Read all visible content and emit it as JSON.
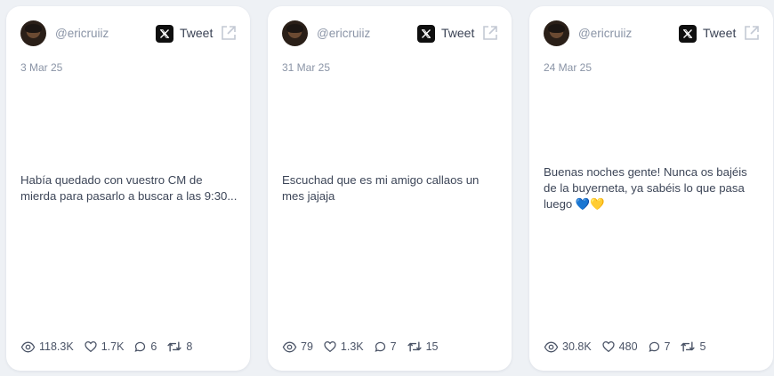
{
  "cards": [
    {
      "handle": "@ericruiiz",
      "source_label": "Tweet",
      "date": "3 Mar 25",
      "text": "Había quedado con vuestro CM de mierda para pasarlo a buscar a las 9:30...",
      "views": "118.3K",
      "likes": "1.7K",
      "replies": "6",
      "retweets": "8"
    },
    {
      "handle": "@ericruiiz",
      "source_label": "Tweet",
      "date": "31 Mar 25",
      "text": "Escuchad que es mi amigo callaos un mes jajaja",
      "views": "79",
      "likes": "1.3K",
      "replies": "7",
      "retweets": "15"
    },
    {
      "handle": "@ericruiiz",
      "source_label": "Tweet",
      "date": "24 Mar 25",
      "text": "Buenas noches gente! Nunca os bajéis de la buyerneta, ya sabéis lo que pasa luego 💙💛",
      "views": "30.8K",
      "likes": "480",
      "replies": "7",
      "retweets": "5"
    }
  ],
  "colors": {
    "background": "#eef1f5",
    "card": "#ffffff",
    "muted": "#8a94a6",
    "text": "#3d4658"
  },
  "icons": [
    "eye-icon",
    "heart-icon",
    "comment-icon",
    "retweet-icon",
    "x-logo-icon",
    "external-link-icon"
  ]
}
